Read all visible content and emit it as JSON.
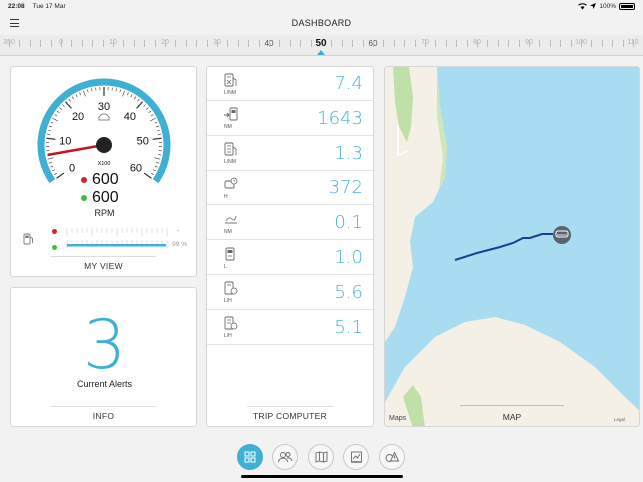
{
  "status_bar": {
    "time": "22:08",
    "date": "Tue 17 Mar",
    "battery": "100%"
  },
  "header": {
    "title": "DASHBOARD"
  },
  "compass": {
    "heading": 50,
    "labels": [
      "350",
      "0",
      "10",
      "20",
      "30",
      "40",
      "50",
      "60",
      "70",
      "80",
      "90",
      "100",
      "110"
    ]
  },
  "my_view": {
    "gauge_labels": [
      "0",
      "10",
      "20",
      "30",
      "40",
      "50",
      "60"
    ],
    "gauge_multiplier": "X100",
    "rpm_values": [
      "600",
      "600"
    ],
    "rpm_label": "RPM",
    "fuel_percent": "99 %",
    "fuel_dash": "-",
    "footer": "MY VIEW",
    "colors": {
      "accent": "#3fb0d4",
      "needle": "#c0161b",
      "dot_red": "#d3212a",
      "dot_green": "#3dbb3a"
    }
  },
  "info": {
    "alert_count": "3",
    "alert_label": "Current Alerts",
    "footer": "INFO"
  },
  "trip_computer": {
    "footer": "TRIP COMPUTER",
    "rows": [
      {
        "unit": "L/NM",
        "value": "7.4",
        "icon": "fuel-economy-icon"
      },
      {
        "unit": "NM",
        "value": "1643",
        "icon": "range-icon"
      },
      {
        "unit": "L/NM",
        "value": "1.3",
        "icon": "fuel-economy-avg-icon"
      },
      {
        "unit": "H",
        "value": "372",
        "icon": "engine-hours-icon"
      },
      {
        "unit": "NM",
        "value": "0.1",
        "icon": "trip-distance-icon"
      },
      {
        "unit": "L",
        "value": "1.0",
        "icon": "fuel-used-icon"
      },
      {
        "unit": "L/H",
        "value": "5.6",
        "icon": "fuel-rate-icon"
      },
      {
        "unit": "L/H",
        "value": "5.1",
        "icon": "avg-fuel-rate-icon"
      }
    ]
  },
  "map": {
    "footer": "MAP",
    "attribution": "Maps",
    "legal": "Legal",
    "colors": {
      "water": "#a8dcf0",
      "land": "#f4f0e6",
      "park": "#bfe0a6",
      "track": "#1f3d8f"
    }
  },
  "tabbar": {
    "items": [
      "dashboard-tab",
      "crew-tab",
      "map-tab",
      "logbook-tab",
      "alerts-tab"
    ]
  }
}
